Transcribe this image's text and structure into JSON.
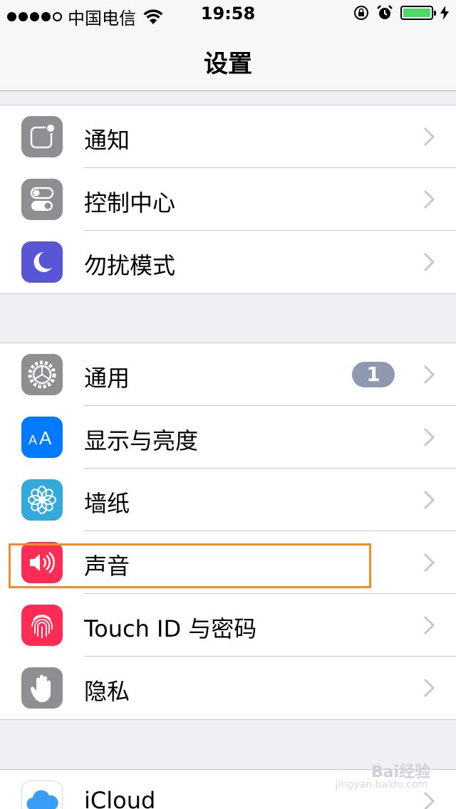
{
  "status_bar": {
    "carrier": "中国电信",
    "time": "19:58"
  },
  "nav": {
    "title": "设置"
  },
  "group1": [
    {
      "label": "通知",
      "icon": "notifications-icon",
      "color": "#8e8e93"
    },
    {
      "label": "控制中心",
      "icon": "control-center-icon",
      "color": "#8e8e93"
    },
    {
      "label": "勿扰模式",
      "icon": "moon-icon",
      "color": "#5856d6"
    }
  ],
  "group2": [
    {
      "label": "通用",
      "icon": "gear-icon",
      "color": "#8e8e93",
      "badge": "1"
    },
    {
      "label": "显示与亮度",
      "icon": "text-size-icon",
      "color": "#007aff"
    },
    {
      "label": "墙纸",
      "icon": "flower-icon",
      "color": "#34aadc"
    },
    {
      "label": "声音",
      "icon": "speaker-icon",
      "color": "#ff2d55"
    },
    {
      "label": "Touch ID 与密码",
      "icon": "fingerprint-icon",
      "color": "#ff2d55"
    },
    {
      "label": "隐私",
      "icon": "hand-icon",
      "color": "#8e8e93"
    }
  ],
  "group3": [
    {
      "label": "iCloud",
      "icon": "icloud-icon",
      "color": "#ffffff"
    }
  ],
  "watermark": {
    "brand": "Bai经验",
    "url": "jingyan.baidu.com"
  }
}
